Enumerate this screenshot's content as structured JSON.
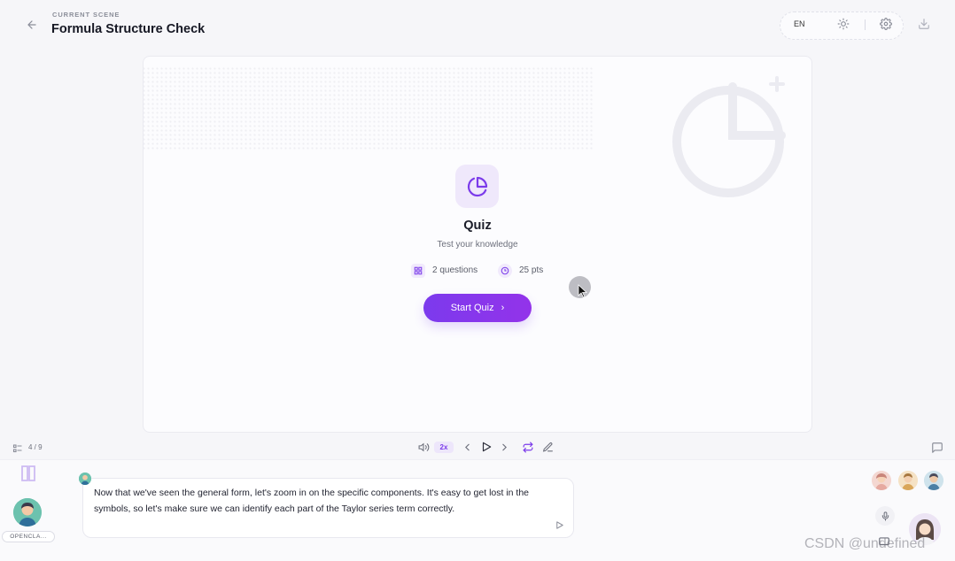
{
  "header": {
    "back_icon": "arrow-left-icon",
    "kicker": "CURRENT SCENE",
    "title": "Formula Structure Check",
    "language": "EN",
    "theme_icon": "sun-icon",
    "settings_icon": "gear-icon",
    "export_icon": "download-icon"
  },
  "quiz": {
    "icon": "pie-chart-icon",
    "title": "Quiz",
    "subtitle": "Test your knowledge",
    "questions_label": "2 questions",
    "points_label": "25 pts",
    "start_label": "Start Quiz",
    "start_chevron": "›",
    "accent": "#7c3aed"
  },
  "playback": {
    "slide_counter": "4 / 9",
    "speed": "2x",
    "icons": [
      "volume-icon",
      "prev-icon",
      "play-icon",
      "next-icon",
      "loop-icon",
      "pen-icon",
      "chat-icon"
    ]
  },
  "agent": {
    "name_badge": "OPENCLA..."
  },
  "speech": {
    "text": "Now that we've seen the general form, let's zoom in on the specific components. It's easy to get lost in the symbols, so let's make sure we can identify each part of the Taylor series term correctly."
  },
  "watermark": "CSDN @undefined"
}
